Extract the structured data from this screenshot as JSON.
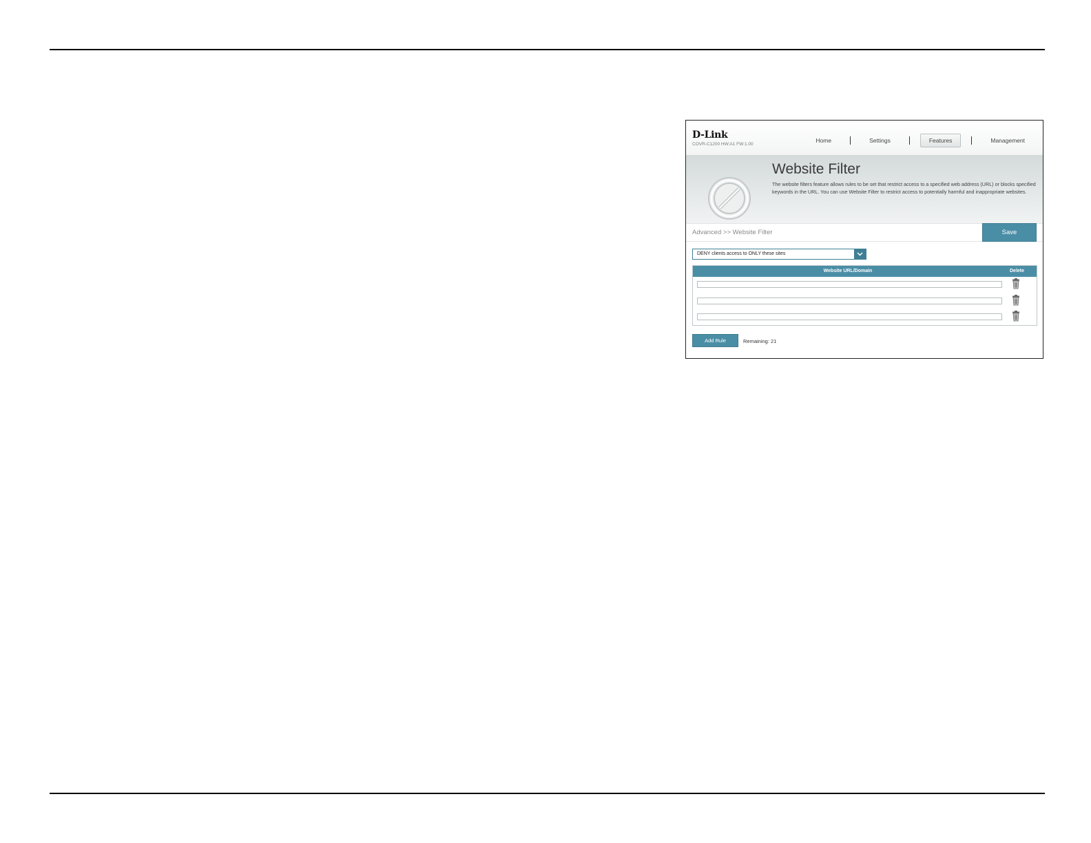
{
  "header": {
    "logo": "D-Link",
    "model_info": "COVR-C1200 HW:A1 FW:1.00",
    "nav": [
      {
        "label": "Home",
        "active": false
      },
      {
        "label": "Settings",
        "active": false
      },
      {
        "label": "Features",
        "active": true
      },
      {
        "label": "Management",
        "active": false
      }
    ]
  },
  "banner": {
    "icon": "no-entry-icon",
    "title": "Website Filter",
    "description": "The website filters feature allows rules to be set that restrict access to a specified web address (URL) or blocks specified keywords in the URL. You can use Website Filter to restrict access to potentially harmful and inappropriate websites."
  },
  "breadcrumb": "Advanced >> Website Filter",
  "save_label": "Save",
  "filter_mode": {
    "selected": "DENY clients access to ONLY these sites",
    "icon": "chevron-down-icon"
  },
  "table": {
    "columns": [
      "Website URL/Domain",
      "Delete"
    ],
    "rows": [
      {
        "url": "",
        "delete_icon": "trash-icon"
      },
      {
        "url": "",
        "delete_icon": "trash-icon"
      },
      {
        "url": "",
        "delete_icon": "trash-icon"
      }
    ]
  },
  "add_rule_label": "Add Rule",
  "remaining_text": "Remaining: 21",
  "colors": {
    "accent": "#4a8ea6",
    "accent_border": "#3d7b90"
  }
}
